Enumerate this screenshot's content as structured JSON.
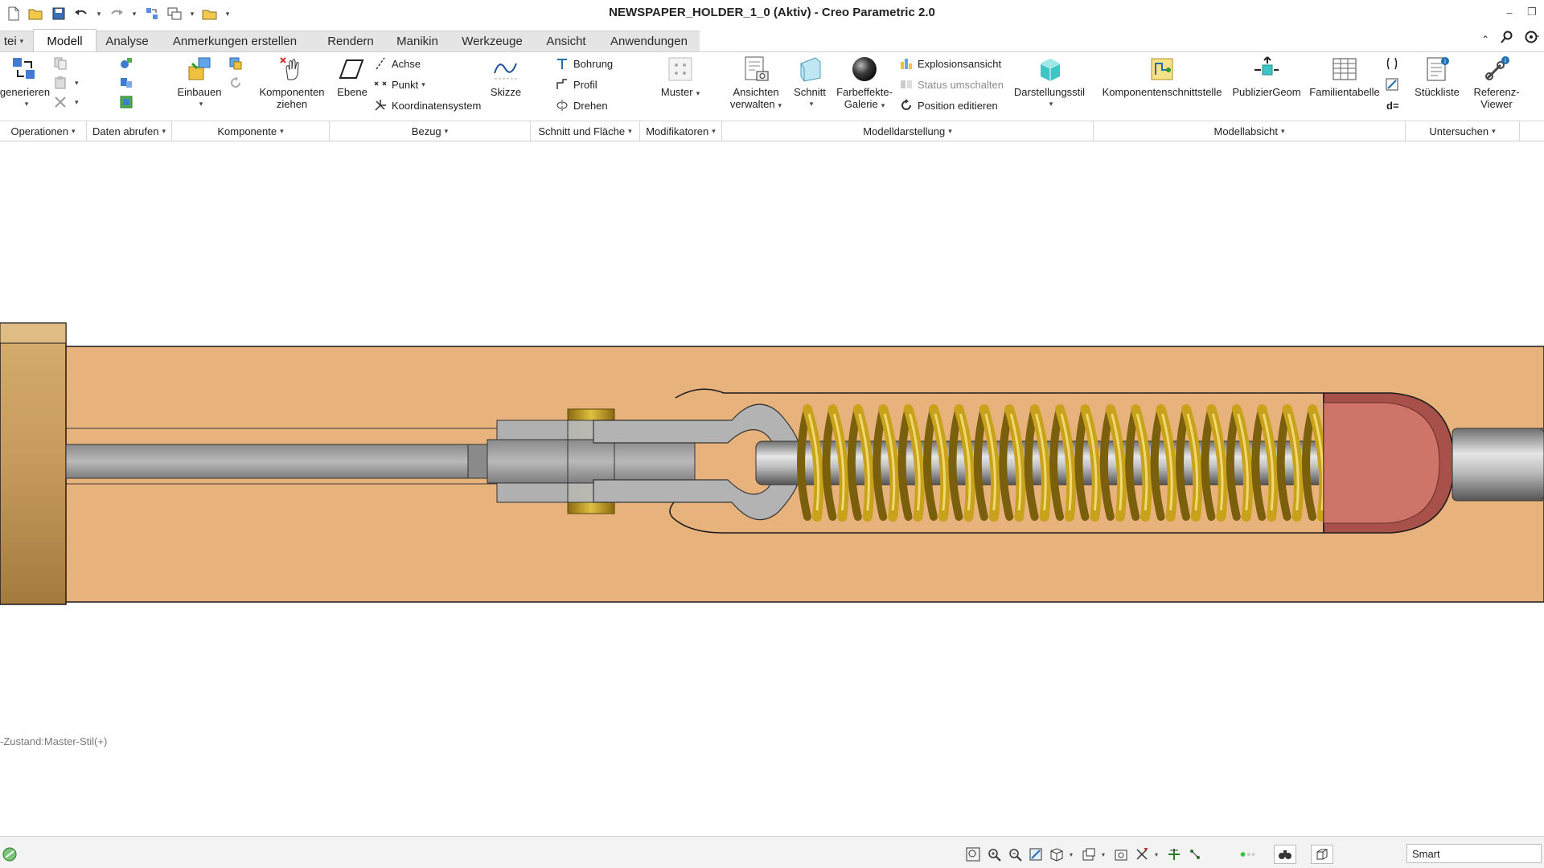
{
  "window": {
    "title": "NEWSPAPER_HOLDER_1_0 (Aktiv) - Creo Parametric 2.0",
    "quick_access": [
      "new-icon",
      "open-icon",
      "save-icon",
      "undo-icon",
      "redo-icon",
      "regenerate-icon",
      "windows-icon",
      "close-window-icon",
      "customize-icon"
    ]
  },
  "tabs": [
    {
      "label": "tei",
      "caret": "▾"
    },
    {
      "label": "Modell",
      "active": true
    },
    {
      "label": "Analyse"
    },
    {
      "label": "Anmerkungen erstellen"
    },
    {
      "label": "Rendern"
    },
    {
      "label": "Manikin"
    },
    {
      "label": "Werkzeuge"
    },
    {
      "label": "Ansicht"
    },
    {
      "label": "Anwendungen"
    }
  ],
  "ribbon": {
    "regenerate": "generieren",
    "assemble": "Einbauen",
    "drag_components": {
      "line1": "Komponenten",
      "line2": "ziehen"
    },
    "plane": "Ebene",
    "axis": "Achse",
    "point": "Punkt",
    "csys": "Koordinatensystem",
    "sketch": "Skizze",
    "hole": "Bohrung",
    "profile": "Profil",
    "revolve": "Drehen",
    "pattern": "Muster",
    "manage_views": {
      "line1": "Ansichten",
      "line2": "verwalten"
    },
    "section": "Schnitt",
    "appearance_gallery": {
      "line1": "Farbeffekte-",
      "line2": "Galerie"
    },
    "explode_view": "Explosionsansicht",
    "toggle_status": "Status umschalten",
    "edit_position": "Position editieren",
    "display_style": "Darstellungsstil",
    "component_interface": "Komponentenschnittstelle",
    "publish_geom": "PublizierGeom",
    "family_table": "Familientabelle",
    "bom": "Stückliste",
    "reference_viewer": {
      "line1": "Referenz-",
      "line2": "Viewer"
    },
    "relations_symbol": "d="
  },
  "groups": [
    {
      "label": "Operationen"
    },
    {
      "label": "Daten abrufen"
    },
    {
      "label": "Komponente"
    },
    {
      "label": "Bezug"
    },
    {
      "label": "Schnitt und Fläche"
    },
    {
      "label": "Modifikatoren"
    },
    {
      "label": "Modelldarstellung"
    },
    {
      "label": "Modellabsicht"
    },
    {
      "label": "Untersuchen"
    }
  ],
  "graphics": {
    "state_label": "-Zustand:Master-Stil(+)",
    "colors": {
      "base": "#e8b27c",
      "spring": "#c9a21c",
      "cap": "#cf7469",
      "rod": "#9a9a9a",
      "block": "#c69a5c"
    }
  },
  "statusbar": {
    "filter": "Smart",
    "tools": [
      "refit-icon",
      "zoom-in-icon",
      "zoom-out-icon",
      "repaint-icon",
      "display-style-icon",
      "saved-views-icon",
      "perspective-icon",
      "datum-display-icon",
      "spin-center-icon",
      "annotation-icon"
    ]
  }
}
